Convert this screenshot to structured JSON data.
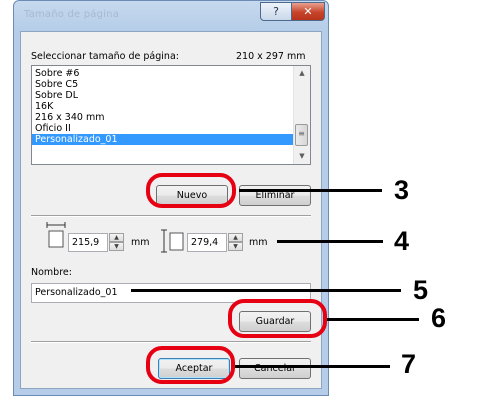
{
  "window": {
    "title": "Tamaño de página",
    "help_glyph": "?",
    "close_glyph": "✕"
  },
  "page_size": {
    "label": "Seleccionar tamaño de página:",
    "dimensions": "210 x 297 mm",
    "items": [
      "Sobre #6",
      "Sobre C5",
      "Sobre DL",
      "16K",
      "216 x 340 mm",
      "Oficio II",
      "Personalizado_01"
    ],
    "selected": "Personalizado_01"
  },
  "buttons": {
    "new": "Nuevo",
    "delete": "Eliminar",
    "save": "Guardar",
    "ok": "Aceptar",
    "cancel": "Cancelar"
  },
  "dimensions": {
    "width_value": "215,9",
    "height_value": "279,4",
    "unit": "mm"
  },
  "name": {
    "label": "Nombre:",
    "value": "Personalizado_01"
  },
  "callouts": [
    "3",
    "4",
    "5",
    "6",
    "7"
  ],
  "colors": {
    "ring": "#e60012",
    "selection": "#3399ff"
  }
}
